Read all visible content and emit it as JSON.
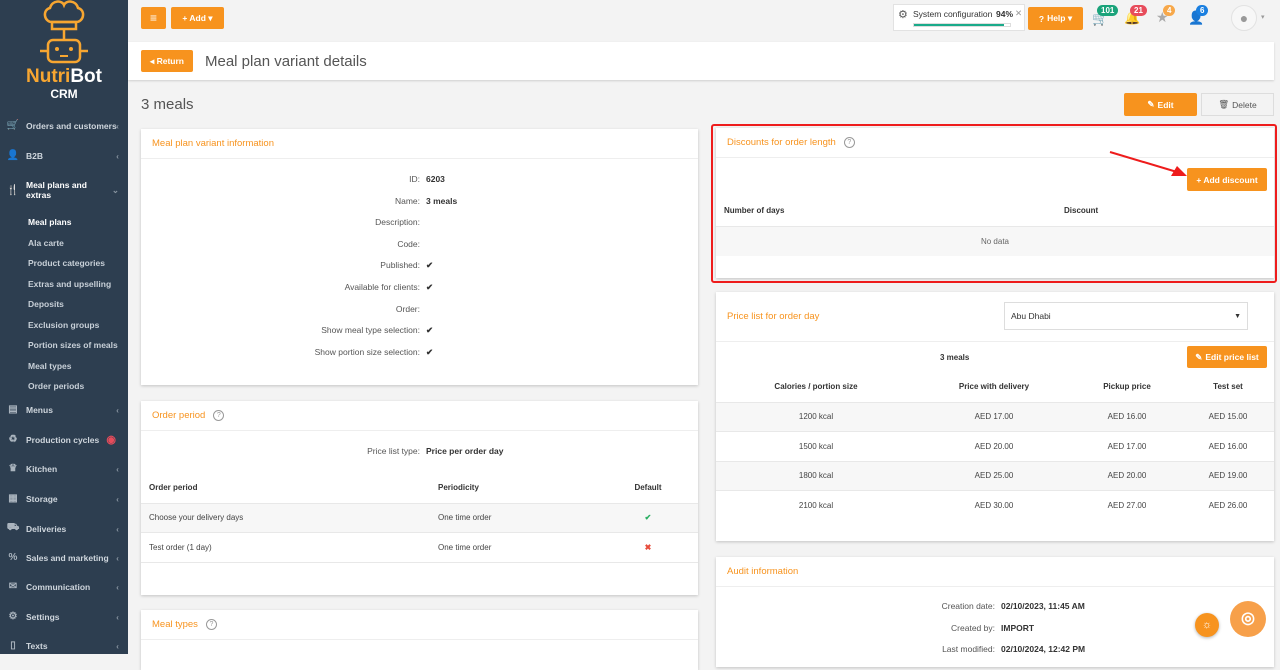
{
  "brand": {
    "name_a": "Nutri",
    "name_b": "Bot",
    "sub": "CRM",
    "color": "#f7a631"
  },
  "sidebar": {
    "items": [
      {
        "label": "Orders and customers",
        "icon": "cart-icon"
      },
      {
        "label": "B2B",
        "icon": "user-tie-icon"
      },
      {
        "label": "Meal plans and",
        "label2": "extras",
        "icon": "utensils-icon"
      },
      {
        "label": "Menus",
        "icon": "menu-book-icon"
      },
      {
        "label": "Production cycles",
        "icon": "recycle-icon"
      },
      {
        "label": "Kitchen",
        "icon": "chef-hat-icon"
      },
      {
        "label": "Storage",
        "icon": "boxes-icon"
      },
      {
        "label": "Deliveries",
        "icon": "truck-icon"
      },
      {
        "label": "Sales and marketing",
        "icon": "percent-icon"
      },
      {
        "label": "Communication",
        "icon": "envelope-icon"
      },
      {
        "label": "Settings",
        "icon": "gear-icon"
      },
      {
        "label": "Texts",
        "icon": "document-icon"
      }
    ],
    "sub": [
      "Meal plans",
      "Ala carte",
      "Product categories",
      "Extras and upselling",
      "Deposits",
      "Exclusion groups",
      "Portion sizes of meals",
      "Meal types",
      "Order periods"
    ]
  },
  "topbar": {
    "add": "+ Add ▾",
    "menu": "≡",
    "sysconf": "System configuration",
    "sysconf_pct": "94%",
    "sysconf_progress": 94,
    "help": "Help ▾",
    "badges": {
      "cart": "101",
      "bell": "21",
      "star": "4",
      "users": "6"
    }
  },
  "header": {
    "return": "◂ Return",
    "title": "Meal plan variant details"
  },
  "page": {
    "title": "3 meals",
    "edit": "Edit",
    "delete": "Delete"
  },
  "info": {
    "title": "Meal plan variant information",
    "rows": [
      {
        "k": "ID:",
        "v": "6203"
      },
      {
        "k": "Name:",
        "v": "3 meals"
      },
      {
        "k": "Description:",
        "v": ""
      },
      {
        "k": "Code:",
        "v": ""
      },
      {
        "k": "Published:",
        "v": "✔"
      },
      {
        "k": "Available for clients:",
        "v": "✔"
      },
      {
        "k": "Order:",
        "v": ""
      },
      {
        "k": "Show meal type selection:",
        "v": "✔"
      },
      {
        "k": "Show portion size selection:",
        "v": "✔"
      }
    ]
  },
  "order_period": {
    "title": "Order period",
    "plt_label": "Price list type:",
    "plt_value": "Price per order day",
    "headers": [
      "Order period",
      "Periodicity",
      "Default"
    ],
    "rows": [
      {
        "a": "Choose your delivery days",
        "b": "One time order",
        "c": "✔"
      },
      {
        "a": "Test order (1 day)",
        "b": "One time order",
        "c": "✖"
      }
    ]
  },
  "meal_types": {
    "title": "Meal types"
  },
  "discounts": {
    "title": "Discounts for order length",
    "add": "+ Add discount",
    "headers": [
      "Number of days",
      "Discount"
    ],
    "empty": "No data"
  },
  "price_list": {
    "title": "Price list for order day",
    "location": "Abu Dhabi",
    "subtitle": "3 meals",
    "edit": "Edit price list",
    "headers": [
      "Calories / portion size",
      "Price with delivery",
      "Pickup price",
      "Test set"
    ],
    "rows": [
      [
        "1200 kcal",
        "AED 17.00",
        "AED 16.00",
        "AED 15.00"
      ],
      [
        "1500 kcal",
        "AED 20.00",
        "AED 17.00",
        "AED 16.00"
      ],
      [
        "1800 kcal",
        "AED 25.00",
        "AED 20.00",
        "AED 19.00"
      ],
      [
        "2100 kcal",
        "AED 30.00",
        "AED 27.00",
        "AED 26.00"
      ]
    ]
  },
  "audit": {
    "title": "Audit information",
    "rows": [
      {
        "k": "Creation date:",
        "v": "02/10/2023, 11:45 AM"
      },
      {
        "k": "Created by:",
        "v": "IMPORT"
      },
      {
        "k": "Last modified:",
        "v": "02/10/2024, 12:42 PM"
      }
    ]
  }
}
